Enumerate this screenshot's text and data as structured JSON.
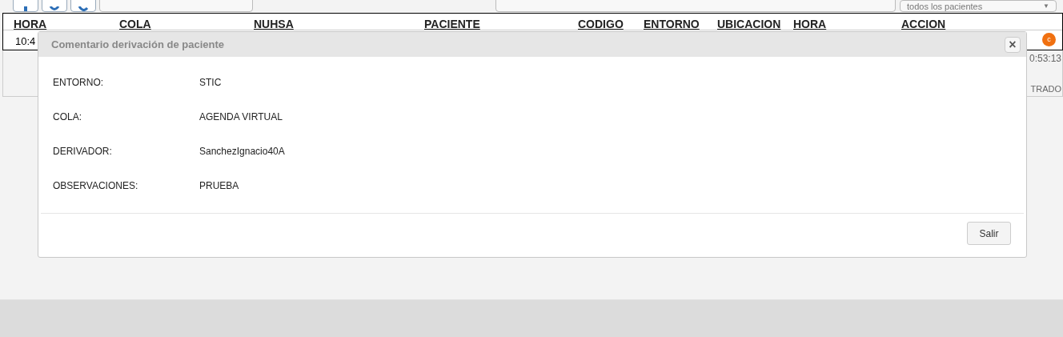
{
  "toolbar": {
    "filter_select": "todos los pacientes",
    "caret": "▼"
  },
  "table": {
    "columns": [
      "HORA",
      "COLA",
      "NUHSA",
      "PACIENTE",
      "CODIGO",
      "ENTORNO",
      "UBICACION",
      "HORA",
      "ACCION"
    ],
    "rows": [
      {
        "cells": [
          "10:4"
        ],
        "action_badge": "c"
      }
    ]
  },
  "timer": "0:53:13",
  "side_label": "TRADO",
  "dialog": {
    "title": "Comentario derivación de paciente",
    "close": "×",
    "fields": [
      {
        "label": "ENTORNO:",
        "value": "STIC"
      },
      {
        "label": "COLA:",
        "value": "AGENDA VIRTUAL"
      },
      {
        "label": "DERIVADOR:",
        "value": "SanchezIgnacio40A"
      },
      {
        "label": "OBSERVACIONES:",
        "value": "PRUEBA"
      }
    ],
    "buttons": [
      "Salir"
    ]
  }
}
